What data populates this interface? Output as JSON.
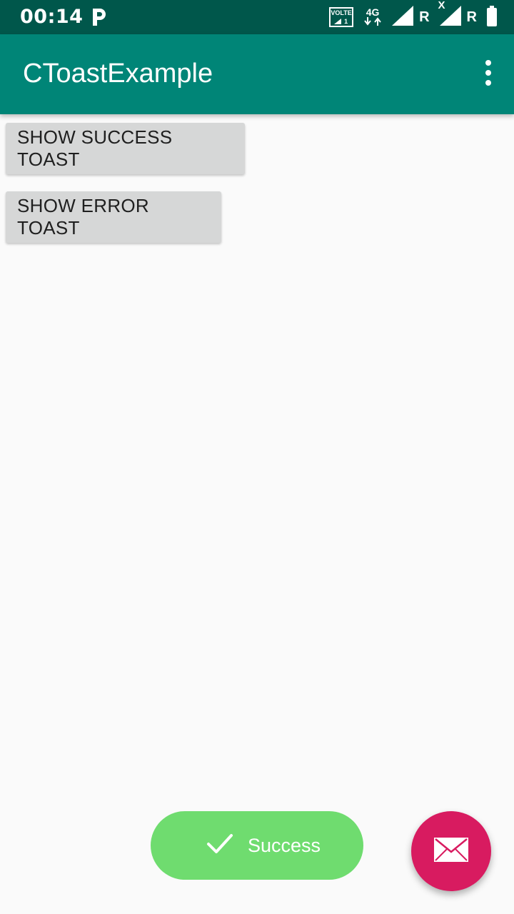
{
  "status_bar": {
    "time": "00:14",
    "volte_label": "VOLTE",
    "sim_number": "1",
    "network_type": "4G",
    "roaming_1": "R",
    "roaming_2": "R",
    "no_signal_mark": "X"
  },
  "app_bar": {
    "title": "CToastExample",
    "overflow_icon": "more-vert-icon"
  },
  "buttons": {
    "success_label": "SHOW SUCCESS TOAST",
    "error_label": "SHOW ERROR TOAST"
  },
  "toast": {
    "icon": "check-icon",
    "message": "Success",
    "background": "#6fdc6f"
  },
  "fab": {
    "icon": "mail-icon",
    "color": "#d81b60"
  },
  "colors": {
    "status_bar": "#00574b",
    "primary": "#008577",
    "background": "#fafafa",
    "button": "#d6d7d7"
  }
}
